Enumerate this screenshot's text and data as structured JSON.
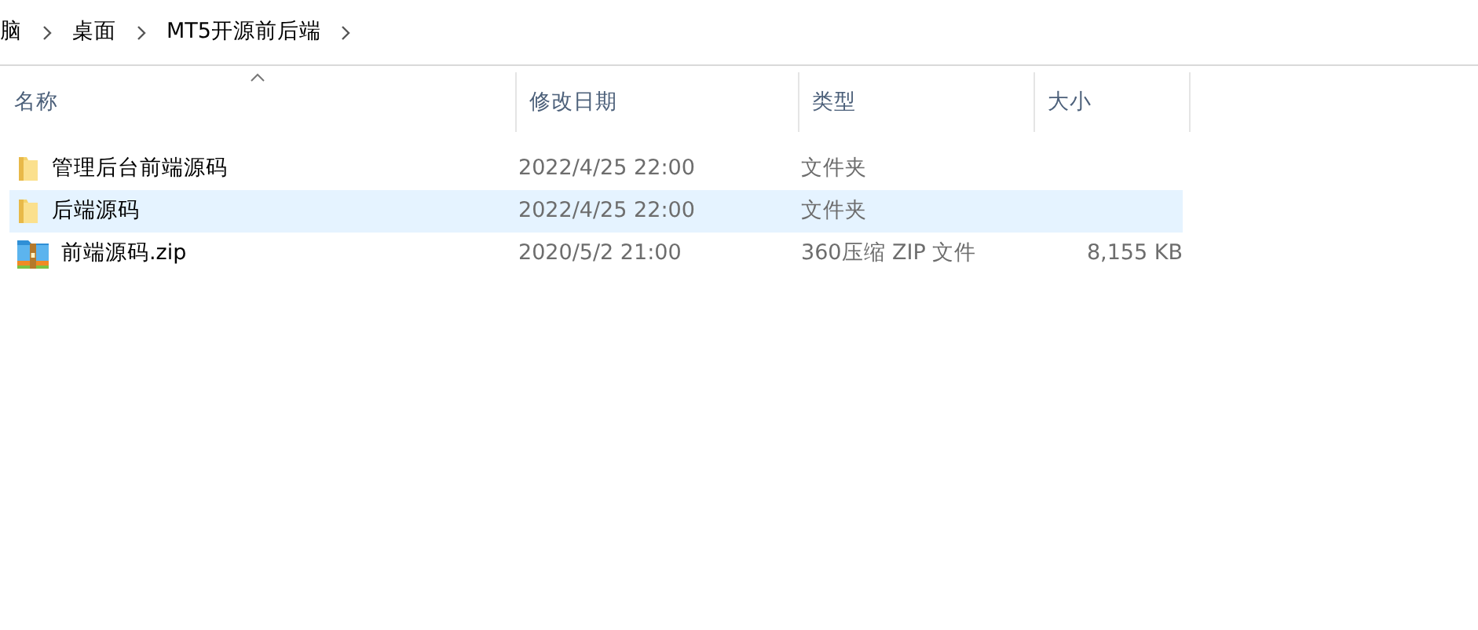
{
  "breadcrumb": [
    "脑",
    "桌面",
    "MT5开源前后端"
  ],
  "table": {
    "columns": [
      {
        "label": "名称",
        "sorted": true
      },
      {
        "label": "修改日期",
        "sorted": false
      },
      {
        "label": "类型",
        "sorted": false
      },
      {
        "label": "大小",
        "sorted": false
      }
    ],
    "rows": [
      {
        "kind": "folder",
        "name": "管理后台前端源码",
        "date": "2022/4/25 22:00",
        "type": "文件夹",
        "selected": false
      },
      {
        "kind": "folder",
        "name": "后端源码",
        "date": "2022/4/25 22:00",
        "type": "文件夹",
        "selected": true
      },
      {
        "kind": "archive",
        "name": "前端源码.zip",
        "date": "2020/5/2 21:00",
        "type": "360压缩 ZIP 文件",
        "size": "8,155 KB",
        "selected": false
      }
    ]
  }
}
